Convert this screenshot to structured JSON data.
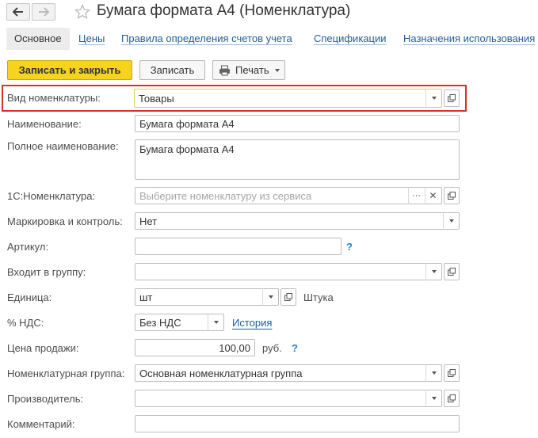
{
  "window": {
    "title": "Бумага формата А4 (Номенклатура)"
  },
  "tabs": [
    {
      "label": "Основное"
    },
    {
      "label": "Цены"
    },
    {
      "label": "Правила определения счетов учета"
    },
    {
      "label": "Спецификации"
    },
    {
      "label": "Назначения использования"
    }
  ],
  "toolbar": {
    "save_close_label": "Записать и закрыть",
    "save_label": "Записать",
    "print_label": "Печать"
  },
  "form": {
    "kind": {
      "label": "Вид номенклатуры:",
      "value": "Товары"
    },
    "name": {
      "label": "Наименование:",
      "value": "Бумага формата А4"
    },
    "full_name": {
      "label": "Полное наименование:",
      "value": "Бумага формата А4"
    },
    "service_item": {
      "label": "1С:Номенклатура:",
      "placeholder": "Выберите номенклатуру из сервиса"
    },
    "marking": {
      "label": "Маркировка и контроль:",
      "value": "Нет"
    },
    "article": {
      "label": "Артикул:",
      "value": "",
      "help": "?"
    },
    "group": {
      "label": "Входит в группу:",
      "value": ""
    },
    "unit": {
      "label": "Единица:",
      "value": "шт",
      "note": "Штука"
    },
    "vat": {
      "label": "% НДС:",
      "value": "Без НДС",
      "link": "История"
    },
    "price": {
      "label": "Цена продажи:",
      "value": "100,00",
      "currency": "руб.",
      "help": "?"
    },
    "item_group": {
      "label": "Номенклатурная группа:",
      "value": "Основная номенклатурная группа"
    },
    "manufacturer": {
      "label": "Производитель:",
      "value": ""
    },
    "comment": {
      "label": "Комментарий:",
      "value": ""
    }
  },
  "colors": {
    "accent_button": "#f5d31f",
    "highlight_border": "#d9302c",
    "link": "#1f5c99"
  }
}
